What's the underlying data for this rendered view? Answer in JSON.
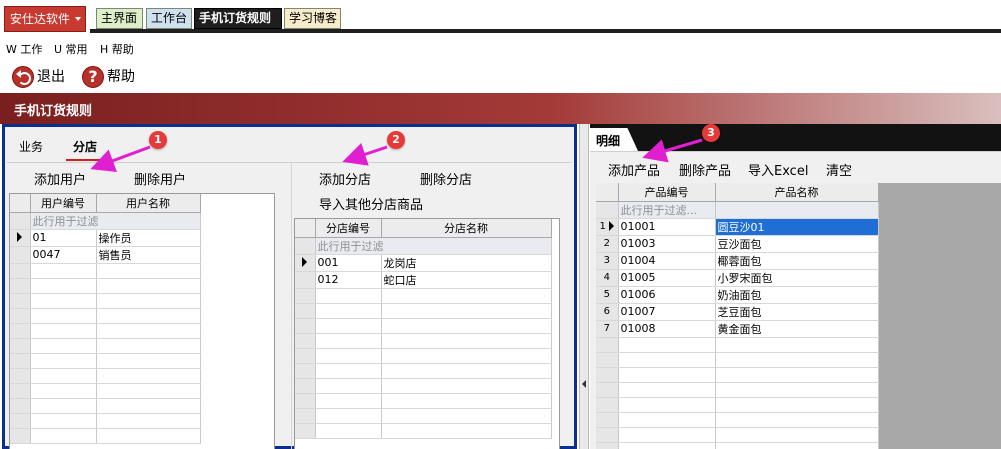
{
  "app": {
    "brand": "安仕达软件"
  },
  "tabs": {
    "main": "主界面",
    "work": "工作台",
    "rule": "手机订货规则",
    "blog": "学习博客"
  },
  "menu": {
    "work": "W 工作",
    "common": "U 常用",
    "help": "H 帮助"
  },
  "toolbar": {
    "exit": "退出",
    "help": "帮助"
  },
  "section": {
    "title": "手机订货规则"
  },
  "left": {
    "tabs": {
      "business": "业务",
      "store": "分店"
    },
    "user_buttons": {
      "add": "添加用户",
      "delete": "删除用户"
    },
    "store_buttons": {
      "add": "添加分店",
      "delete": "删除分店",
      "import": "导入其他分店商品"
    },
    "user_grid": {
      "headers": [
        "用户编号",
        "用户名称"
      ],
      "filter": "此行用于过滤",
      "rows": [
        [
          "01",
          "操作员"
        ],
        [
          "0047",
          "销售员"
        ]
      ]
    },
    "store_grid": {
      "headers": [
        "分店编号",
        "分店名称"
      ],
      "filter": "此行用于过滤",
      "rows": [
        [
          "001",
          "龙岗店"
        ],
        [
          "012",
          "蛇口店"
        ]
      ]
    }
  },
  "right": {
    "tab": "明细",
    "buttons": {
      "add": "添加产品",
      "delete": "删除产品",
      "import": "导入Excel",
      "clear": "清空"
    },
    "product_grid": {
      "headers": [
        "产品编号",
        "产品名称"
      ],
      "filter": "此行用于过滤...",
      "rows": [
        [
          "1",
          "01001",
          "圆豆沙01"
        ],
        [
          "2",
          "01003",
          "豆沙面包"
        ],
        [
          "3",
          "01004",
          "椰蓉面包"
        ],
        [
          "4",
          "01005",
          "小罗宋面包"
        ],
        [
          "5",
          "01006",
          "奶油面包"
        ],
        [
          "6",
          "01007",
          "芝豆面包"
        ],
        [
          "7",
          "01008",
          "黄金面包"
        ]
      ]
    }
  },
  "callouts": [
    "1",
    "2",
    "3"
  ],
  "colors": {
    "brand": "#c83a30",
    "panel_border": "#0b2f8c",
    "callout": "#e63a3a",
    "arrow": "#e020d0",
    "selection": "#1e6ed6"
  }
}
